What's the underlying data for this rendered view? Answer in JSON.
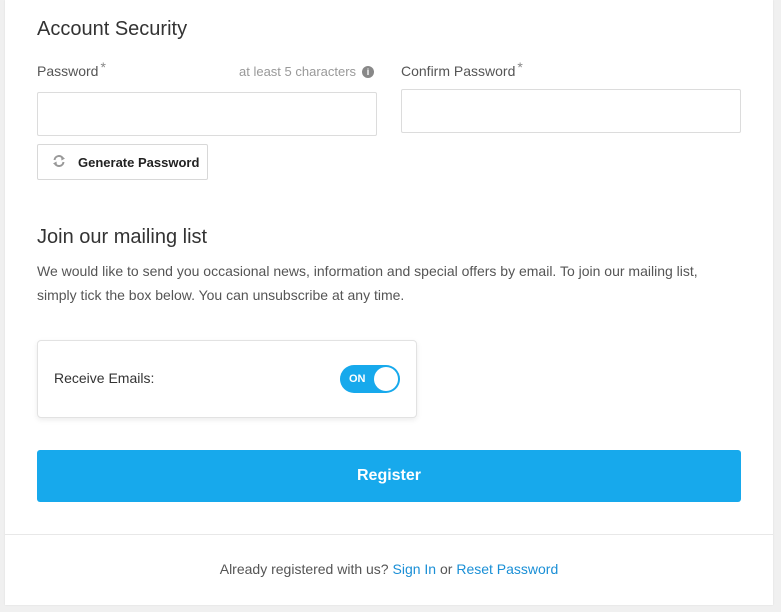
{
  "account_security": {
    "title": "Account Security",
    "password_label": "Password",
    "password_required": "*",
    "password_hint": "at least 5 characters",
    "password_value": "",
    "confirm_label": "Confirm Password",
    "confirm_required": "*",
    "confirm_value": "",
    "generate_button": "Generate Password"
  },
  "mailing_list": {
    "title": "Join our mailing list",
    "description": "We would like to send you occasional news, information and special offers by email. To join our mailing list, simply tick the box below. You can unsubscribe at any time.",
    "receive_label": "Receive Emails:",
    "toggle_state": "ON"
  },
  "register_button": "Register",
  "footer": {
    "prefix": "Already registered with us?",
    "sign_in": "Sign In",
    "or": "or",
    "reset_password": "Reset Password"
  },
  "colors": {
    "accent": "#17a9ec",
    "link": "#1a8fd6"
  }
}
